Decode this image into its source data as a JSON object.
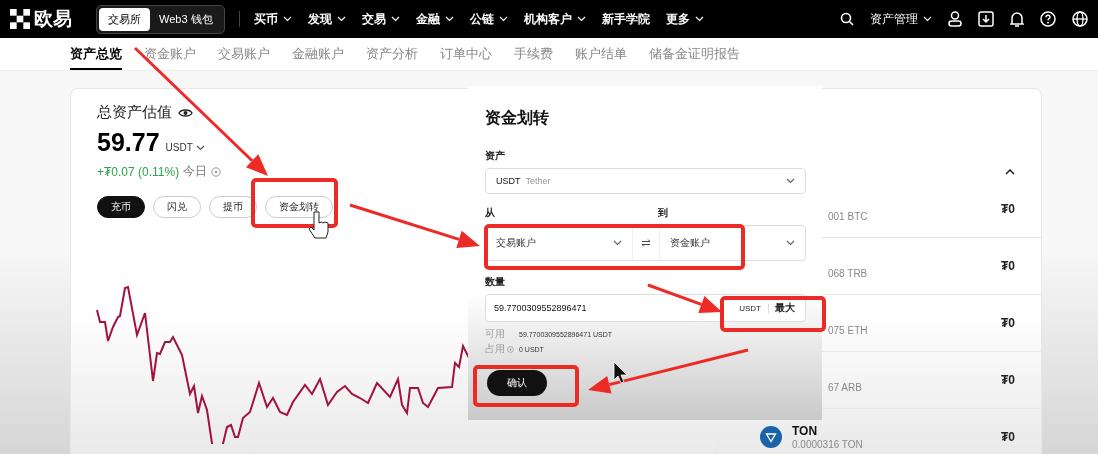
{
  "nav": {
    "logo": "欧易",
    "mode_tabs": [
      {
        "label": "交易所",
        "selected": true
      },
      {
        "label": "Web3 钱包",
        "selected": false
      }
    ],
    "menu": [
      {
        "label": "买币",
        "dropdown": true
      },
      {
        "label": "发现",
        "dropdown": true
      },
      {
        "label": "交易",
        "dropdown": true
      },
      {
        "label": "金融",
        "dropdown": true
      },
      {
        "label": "公链",
        "dropdown": true
      },
      {
        "label": "机构客户",
        "dropdown": true
      },
      {
        "label": "新手学院",
        "dropdown": false
      },
      {
        "label": "更多",
        "dropdown": true
      }
    ],
    "asset_menu": "资产管理"
  },
  "subtabs": [
    {
      "label": "资产总览",
      "selected": true
    },
    {
      "label": "资金账户",
      "selected": false
    },
    {
      "label": "交易账户",
      "selected": false
    },
    {
      "label": "金融账户",
      "selected": false
    },
    {
      "label": "资产分析",
      "selected": false
    },
    {
      "label": "订单中心",
      "selected": false
    },
    {
      "label": "手续费",
      "selected": false
    },
    {
      "label": "账户结单",
      "selected": false
    },
    {
      "label": "储备金证明报告",
      "selected": false
    }
  ],
  "overview": {
    "title": "总资产估值",
    "amount": "59.77",
    "currency": "USDT",
    "change": "+₮0.07 (0.11%)",
    "period": "今日",
    "actions": [
      {
        "label": "充币",
        "primary": true
      },
      {
        "label": "闪兑",
        "primary": false
      },
      {
        "label": "提币",
        "primary": false
      },
      {
        "label": "资金划转",
        "primary": false
      }
    ]
  },
  "assets": [
    {
      "kind": "partial",
      "amount": "001 BTC",
      "value": "₮0"
    },
    {
      "kind": "partial",
      "amount": "068 TRB",
      "value": "₮0"
    },
    {
      "kind": "partial",
      "amount": "075 ETH",
      "value": "₮0"
    },
    {
      "kind": "partial",
      "amount": "67 ARB",
      "value": "₮0"
    },
    {
      "kind": "full",
      "symbol": "TON",
      "amount": "0.0000316 TON",
      "value": "₮0"
    }
  ],
  "transfer_dialog": {
    "title": "资金划转",
    "asset_label": "资产",
    "asset_symbol": "USDT",
    "asset_name": "Tether",
    "from_label": "从",
    "to_label": "到",
    "from": "交易账户",
    "to": "资金账户",
    "amount_label": "数量",
    "amount": "59.7700309552896471",
    "unit": "USDT",
    "max": "最大",
    "available_label": "可用",
    "available": "59.7700309552896471 USDT",
    "occupied_label": "占用",
    "occupied": "0 USDT",
    "confirm": "确认"
  }
}
